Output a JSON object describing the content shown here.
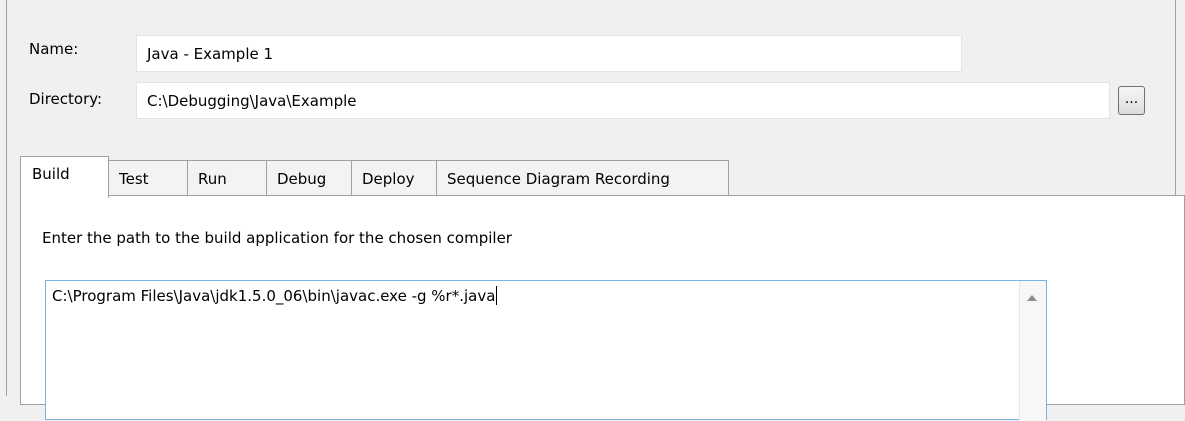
{
  "form": {
    "name_label": "Name:",
    "name_value": "Java - Example 1",
    "directory_label": "Directory:",
    "directory_value": "C:\\Debugging\\Java\\Example",
    "browse_label": "..."
  },
  "tabs": [
    {
      "label": "Build",
      "active": true
    },
    {
      "label": "Test",
      "active": false
    },
    {
      "label": "Run",
      "active": false
    },
    {
      "label": "Debug",
      "active": false
    },
    {
      "label": "Deploy",
      "active": false
    },
    {
      "label": "Sequence Diagram Recording",
      "active": false
    }
  ],
  "build_panel": {
    "instruction": "Enter the path to the build application for the chosen compiler",
    "command": "C:\\Program Files\\Java\\jdk1.5.0_06\\bin\\javac.exe -g %r*.java"
  },
  "colors": {
    "focus_border": "#7ab4e6",
    "window_background": "#f0f0f0"
  }
}
